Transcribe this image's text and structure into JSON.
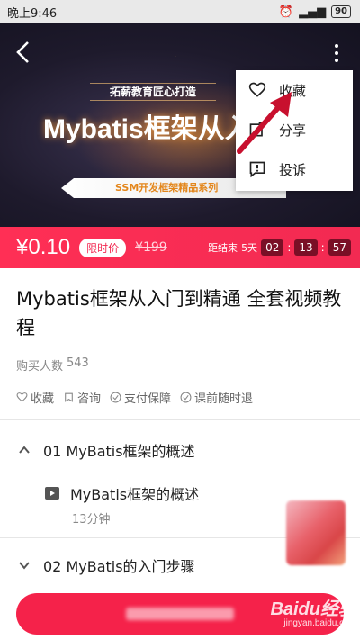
{
  "status_bar": {
    "time": "晚上9:46",
    "battery": "90"
  },
  "banner": {
    "subtitle": "拓薪教育匠心打造",
    "title": "Mybatis框架从入门",
    "ribbon": "SSM开发框架精品系列"
  },
  "menu": {
    "items": [
      {
        "label": "收藏",
        "icon": "heart-icon"
      },
      {
        "label": "分享",
        "icon": "share-icon"
      },
      {
        "label": "投诉",
        "icon": "report-icon"
      }
    ]
  },
  "annotation_color": "#c8102e",
  "price_bar": {
    "price": "¥0.10",
    "badge": "限时价",
    "original_price": "¥199",
    "countdown_label": "距结束",
    "days": "5天",
    "hours": "02",
    "minutes": "13",
    "seconds": "57",
    "bg_color": "#f22a52"
  },
  "course": {
    "title": "Mybatis框架从入门到精通 全套视频教程",
    "buyers_label": "购买人数",
    "buyers_count": "543",
    "features": [
      "收藏",
      "咨询",
      "支付保障",
      "课前随时退"
    ]
  },
  "chapters": [
    {
      "label": "01 MyBatis框架的概述",
      "expanded": true
    },
    {
      "label": "02 MyBatis的入门步骤",
      "expanded": false
    }
  ],
  "lesson": {
    "title": "MyBatis框架的概述",
    "duration": "13分钟"
  },
  "watermark": {
    "main": "Baidu经验",
    "sub": "jingyan.baidu.com"
  }
}
